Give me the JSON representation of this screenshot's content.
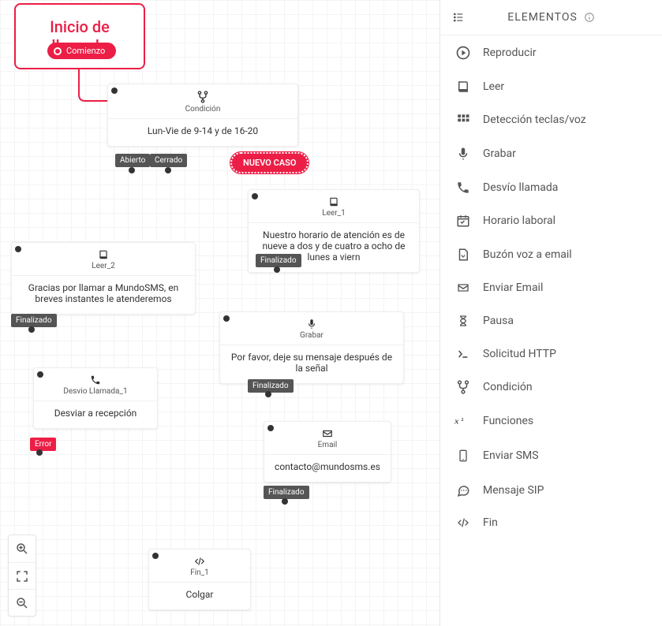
{
  "sidebar": {
    "title": "ELEMENTOS",
    "items": [
      {
        "label": "Reproducir",
        "icon": "play-circle-icon"
      },
      {
        "label": "Leer",
        "icon": "book-icon"
      },
      {
        "label": "Detección teclas/voz",
        "icon": "keypad-icon"
      },
      {
        "label": "Grabar",
        "icon": "microphone-icon"
      },
      {
        "label": "Desvío llamada",
        "icon": "phone-icon"
      },
      {
        "label": "Horario laboral",
        "icon": "calendar-icon"
      },
      {
        "label": "Buzón voz a email",
        "icon": "voicemail-file-icon"
      },
      {
        "label": "Enviar Email",
        "icon": "envelope-icon"
      },
      {
        "label": "Pausa",
        "icon": "hourglass-icon"
      },
      {
        "label": "Solicitud HTTP",
        "icon": "terminal-icon"
      },
      {
        "label": "Condición",
        "icon": "branch-icon"
      },
      {
        "label": "Funciones",
        "icon": "fx-icon"
      },
      {
        "label": "Enviar SMS",
        "icon": "smartphone-icon"
      },
      {
        "label": "Mensaje SIP",
        "icon": "chat-bubble-icon"
      },
      {
        "label": "Fin",
        "icon": "code-slash-icon"
      }
    ]
  },
  "flow": {
    "start": {
      "title": "Inicio de llamada",
      "pill": "Comienzo"
    },
    "newCase": "NUEVO CASO",
    "tags": {
      "abierto": "Abierto",
      "cerrado": "Cerrado",
      "finalizado": "Finalizado",
      "error": "Error"
    },
    "nodes": {
      "condicion": {
        "title": "Condición",
        "body": "Lun-Vie de 9-14 y de 16-20"
      },
      "leer1": {
        "title": "Leer_1",
        "body": "Nuestro horario de atención es de nueve a dos y de cuatro a ocho de lunes a viern"
      },
      "leer2": {
        "title": "Leer_2",
        "body": "Gracias por llamar a MundoSMS, en breves instantes le atenderemos"
      },
      "grabar": {
        "title": "Grabar",
        "body": "Por favor, deje su mensaje después de la señal"
      },
      "desvio": {
        "title": "Desvio Llamada_1",
        "body": "Desviar a recepción"
      },
      "email": {
        "title": "Email",
        "body": "contacto@mundosms.es"
      },
      "fin": {
        "title": "Fin_1",
        "body": "Colgar"
      }
    }
  }
}
